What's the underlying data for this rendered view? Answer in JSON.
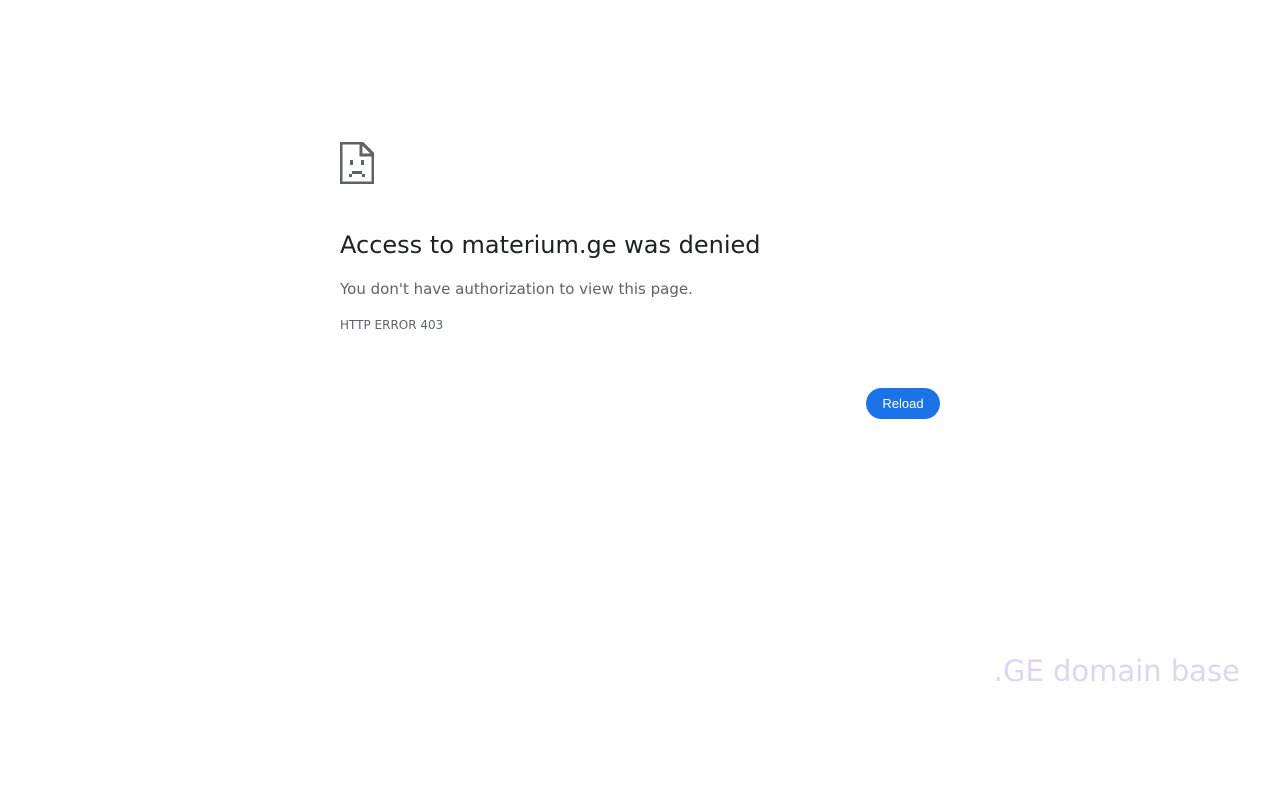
{
  "error_page": {
    "icon": "sad-document-icon",
    "title": "Access to materium.ge was denied",
    "message": "You don't have authorization to view this page.",
    "error_code": "HTTP ERROR 403",
    "reload_label": "Reload"
  },
  "watermark": {
    "text": ".GE domain base"
  },
  "colors": {
    "accent": "#1a73e8",
    "title_text": "#202124",
    "secondary_text": "#5f6368",
    "watermark_text": "#dcd6f2",
    "background": "#ffffff"
  }
}
